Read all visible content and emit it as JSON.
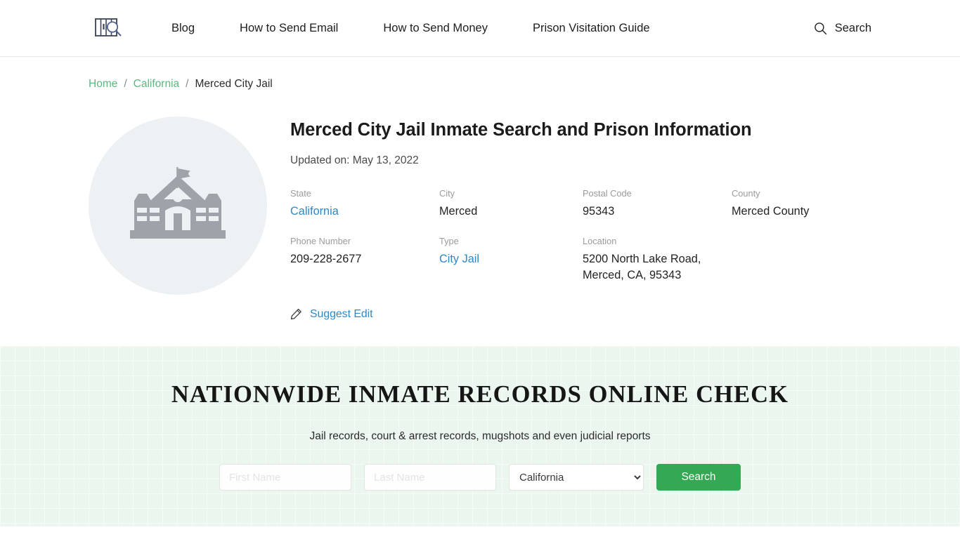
{
  "header": {
    "logo_name": "jail-bars-search-logo",
    "nav": [
      {
        "label": "Blog"
      },
      {
        "label": "How to Send Email"
      },
      {
        "label": "How to Send Money"
      },
      {
        "label": "Prison Visitation Guide"
      }
    ],
    "search": {
      "icon": "search-icon",
      "label": "Search"
    }
  },
  "breadcrumb": {
    "home": "Home",
    "state": "California",
    "current": "Merced City Jail",
    "separator": "/"
  },
  "facility": {
    "photo_icon": "institution-building-icon",
    "title": "Merced City Jail Inmate Search and Prison Information",
    "updated": "Updated on: May 13, 2022",
    "fields": [
      {
        "label": "State",
        "value": "California",
        "link": true
      },
      {
        "label": "City",
        "value": "Merced",
        "link": false
      },
      {
        "label": "Postal Code",
        "value": "95343",
        "link": false
      },
      {
        "label": "County",
        "value": "Merced County",
        "link": false
      },
      {
        "label": "Phone Number",
        "value": "209-228-2677",
        "link": false
      },
      {
        "label": "Type",
        "value": "City Jail",
        "link": true
      },
      {
        "label": "Location",
        "value": "5200 North Lake Road, Merced, CA, 95343",
        "link": false
      }
    ],
    "suggest_edit": {
      "icon": "pencil-icon",
      "label": "Suggest Edit"
    }
  },
  "cta": {
    "title": "NATIONWIDE INMATE RECORDS ONLINE CHECK",
    "subtitle": "Jail records, court & arrest records, mugshots and even judicial reports",
    "first_name_placeholder": "First Name",
    "first_name_value": "",
    "last_name_placeholder": "Last Name",
    "last_name_value": "",
    "state_selected": "California",
    "state_options": [
      "California"
    ],
    "submit_label": "Search"
  },
  "colors": {
    "accent_green": "#34a853",
    "link_blue": "#2b89c8",
    "crumb_green": "#5bb87f",
    "band_background": "#eaf6ee",
    "photo_circle": "#eef1f3"
  }
}
